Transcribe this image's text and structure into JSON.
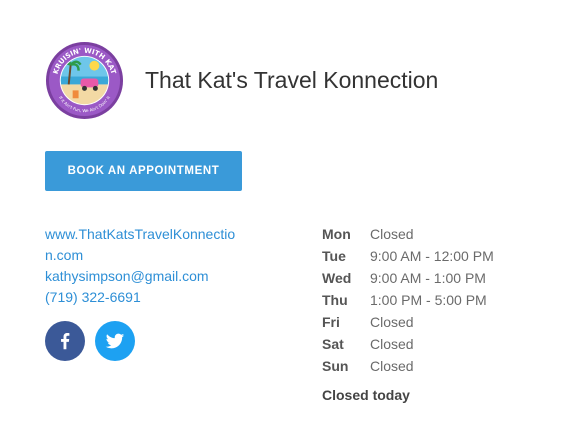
{
  "business": {
    "name": "That Kat's Travel Konnection",
    "logo_top_text": "KRUISIN' WITH KAT",
    "logo_bottom_text": "If it Ain't Fun, We Ain't Doin' It"
  },
  "actions": {
    "book_label": "BOOK AN APPOINTMENT"
  },
  "contact": {
    "website": "www.ThatKatsTravelKonnection.com",
    "email": "kathysimpson@gmail.com",
    "phone": "(719) 322-6691"
  },
  "social": {
    "facebook_icon": "facebook-icon",
    "twitter_icon": "twitter-icon"
  },
  "hours": [
    {
      "day": "Mon",
      "time": "Closed"
    },
    {
      "day": "Tue",
      "time": "9:00 AM - 12:00 PM"
    },
    {
      "day": "Wed",
      "time": "9:00 AM - 1:00 PM"
    },
    {
      "day": "Thu",
      "time": "1:00 PM - 5:00 PM"
    },
    {
      "day": "Fri",
      "time": "Closed"
    },
    {
      "day": "Sat",
      "time": "Closed"
    },
    {
      "day": "Sun",
      "time": "Closed"
    }
  ],
  "status": {
    "today": "Closed today"
  },
  "colors": {
    "accent": "#3a9ad9",
    "link": "#2e8fd6",
    "facebook": "#3b5998",
    "twitter": "#1da1f2"
  }
}
